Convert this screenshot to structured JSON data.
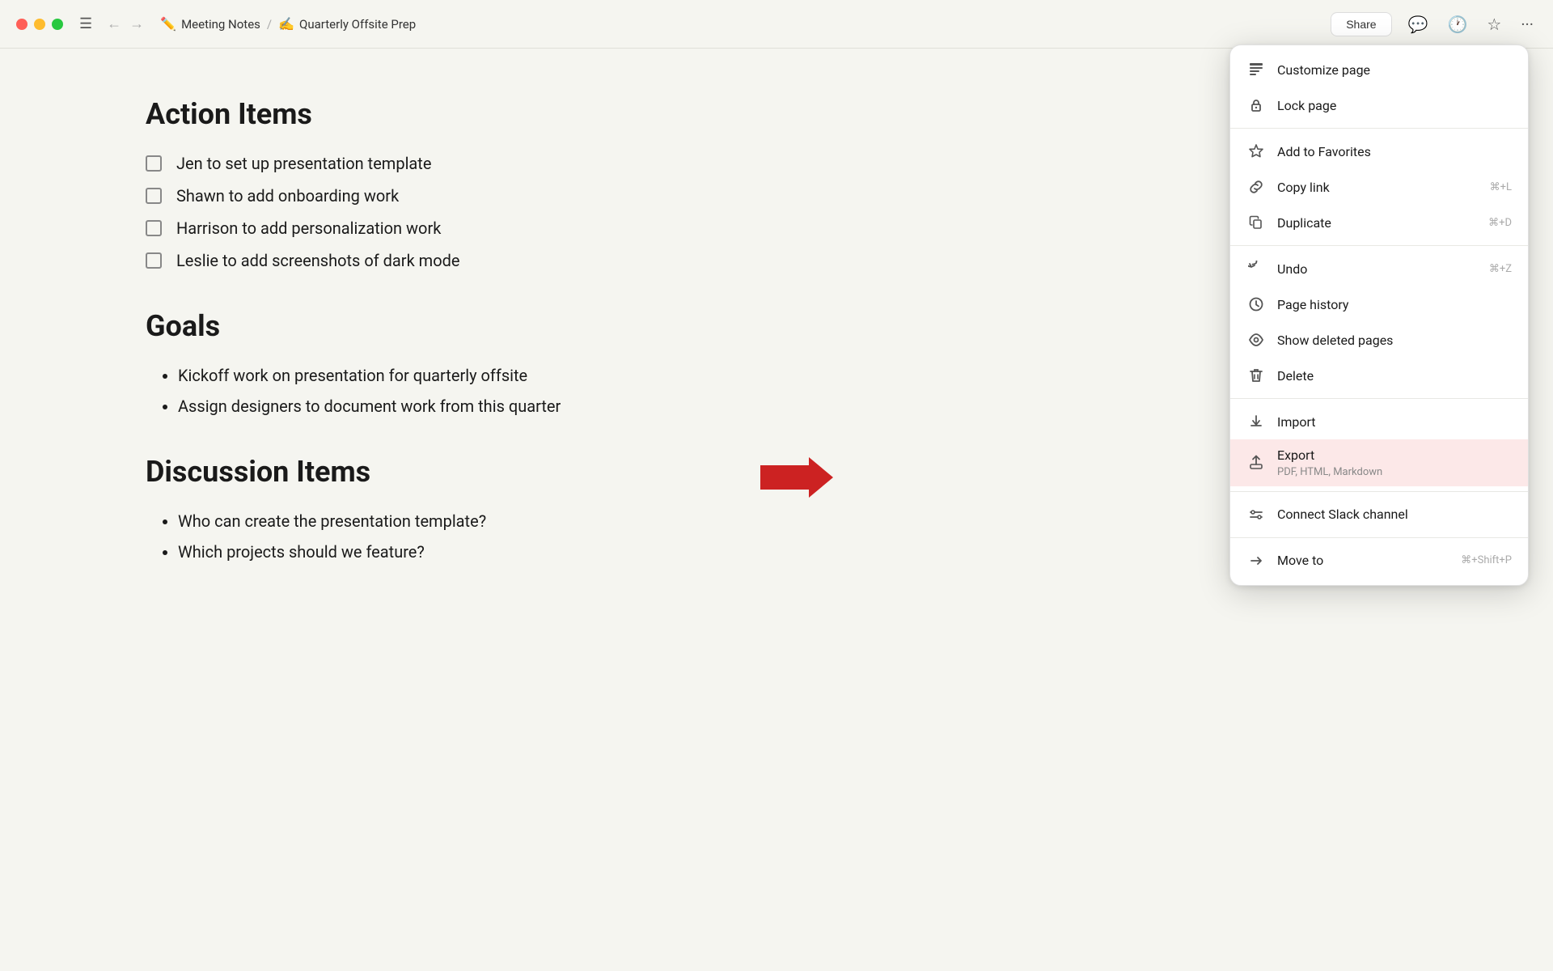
{
  "titlebar": {
    "breadcrumb_parent_icon": "✏️",
    "breadcrumb_parent": "Meeting Notes",
    "breadcrumb_separator": "/",
    "breadcrumb_child_icon": "✍️",
    "breadcrumb_child": "Quarterly Offsite Prep",
    "share_label": "Share"
  },
  "content": {
    "section1_heading": "Action Items",
    "checklist": [
      "Jen to set up presentation template",
      "Shawn to add onboarding work",
      "Harrison to add personalization work",
      "Leslie to add screenshots of dark mode"
    ],
    "section2_heading": "Goals",
    "goals": [
      "Kickoff work on presentation for quarterly offsite",
      "Assign designers to document work from this quarter"
    ],
    "section3_heading": "Discussion Items",
    "discussion": [
      "Who can create the presentation template?",
      "Which projects should we feature?"
    ]
  },
  "menu": {
    "items": [
      {
        "id": "customize-page",
        "icon": "📄",
        "label": "Customize page",
        "shortcut": ""
      },
      {
        "id": "lock-page",
        "icon": "🔒",
        "label": "Lock page",
        "shortcut": ""
      },
      {
        "id": "divider1",
        "type": "divider"
      },
      {
        "id": "add-favorites",
        "icon": "☆",
        "label": "Add to Favorites",
        "shortcut": ""
      },
      {
        "id": "copy-link",
        "icon": "🔗",
        "label": "Copy link",
        "shortcut": "⌘+L"
      },
      {
        "id": "duplicate",
        "icon": "📋",
        "label": "Duplicate",
        "shortcut": "⌘+D"
      },
      {
        "id": "divider2",
        "type": "divider"
      },
      {
        "id": "undo",
        "icon": "↩",
        "label": "Undo",
        "shortcut": "⌘+Z"
      },
      {
        "id": "page-history",
        "icon": "🕐",
        "label": "Page history",
        "shortcut": ""
      },
      {
        "id": "show-deleted",
        "icon": "↺",
        "label": "Show deleted pages",
        "shortcut": ""
      },
      {
        "id": "delete",
        "icon": "🗑",
        "label": "Delete",
        "shortcut": ""
      },
      {
        "id": "divider3",
        "type": "divider"
      },
      {
        "id": "import",
        "icon": "⬇",
        "label": "Import",
        "shortcut": ""
      },
      {
        "id": "export",
        "icon": "📤",
        "label": "Export",
        "sublabel": "PDF, HTML, Markdown",
        "shortcut": "",
        "highlighted": true
      },
      {
        "id": "divider4",
        "type": "divider"
      },
      {
        "id": "connect-slack",
        "icon": "💬",
        "label": "Connect Slack channel",
        "shortcut": ""
      },
      {
        "id": "divider5",
        "type": "divider"
      },
      {
        "id": "move-to",
        "icon": "↪",
        "label": "Move to",
        "shortcut": "⌘+Shift+P"
      }
    ]
  }
}
